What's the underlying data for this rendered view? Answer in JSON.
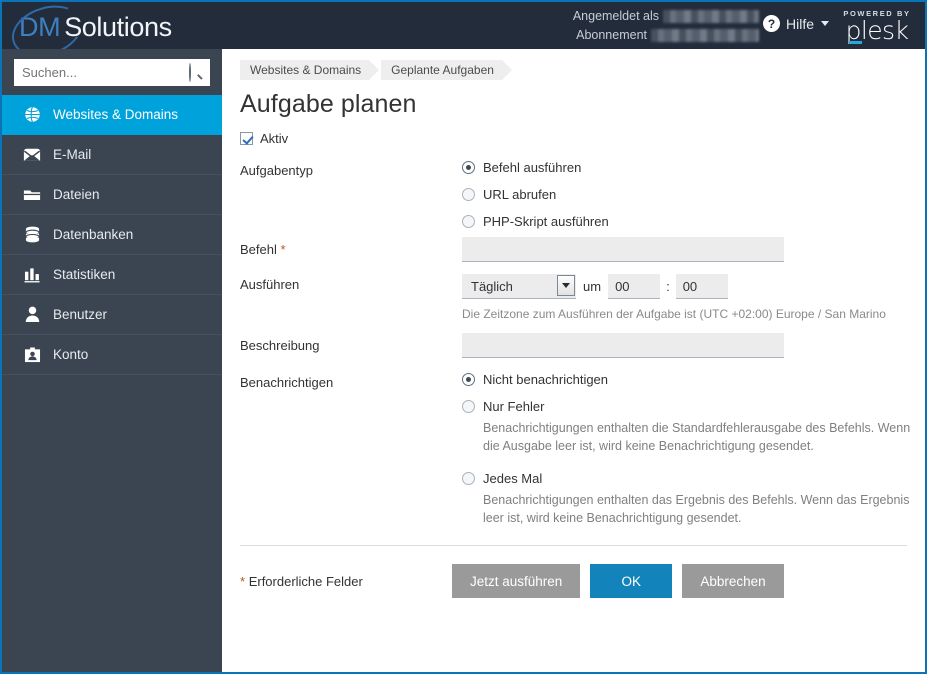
{
  "header": {
    "brand_dm": "DM",
    "brand_solutions": "Solutions",
    "logged_in_label": "Angemeldet als",
    "subscription_label": "Abonnement",
    "logged_in_value": "",
    "subscription_value": "",
    "help_label": "Hilfe",
    "help_icon": "question-mark-circle-icon",
    "caret_icon": "chevron-down-icon",
    "powered_by": "POWERED BY",
    "plesk_word": "plesk",
    "bg_color": "#232c3b",
    "accent_color": "#0a74b8"
  },
  "sidebar": {
    "search": {
      "placeholder": "Suchen...",
      "value": "",
      "icon": "search-icon"
    },
    "active_color": "#00a2db",
    "bg_color": "#3b4552",
    "items": [
      {
        "label": "Websites & Domains",
        "icon": "globe-icon",
        "active": true
      },
      {
        "label": "E-Mail",
        "icon": "envelope-icon",
        "active": false
      },
      {
        "label": "Dateien",
        "icon": "folder-icon",
        "active": false
      },
      {
        "label": "Datenbanken",
        "icon": "database-icon",
        "active": false
      },
      {
        "label": "Statistiken",
        "icon": "bar-chart-icon",
        "active": false
      },
      {
        "label": "Benutzer",
        "icon": "user-icon",
        "active": false
      },
      {
        "label": "Konto",
        "icon": "id-card-icon",
        "active": false
      }
    ]
  },
  "breadcrumb": [
    {
      "label": "Websites & Domains"
    },
    {
      "label": "Geplante Aufgaben"
    }
  ],
  "page": {
    "title": "Aufgabe planen",
    "active_checkbox": {
      "label": "Aktiv",
      "checked": true
    }
  },
  "form": {
    "task_type": {
      "label": "Aufgabentyp",
      "options": [
        {
          "label": "Befehl ausführen",
          "selected": true
        },
        {
          "label": "URL abrufen",
          "selected": false
        },
        {
          "label": "PHP-Skript ausführen",
          "selected": false
        }
      ]
    },
    "command": {
      "label": "Befehl",
      "required_marker": "*",
      "value": "",
      "placeholder": ""
    },
    "run": {
      "label": "Ausführen",
      "frequency_value": "Täglich",
      "at_label": "um",
      "hour_value": "00",
      "colon": ":",
      "minute_value": "00",
      "timezone_hint": "Die Zeitzone zum Ausführen der Aufgabe ist (UTC +02:00) Europe / San Marino"
    },
    "description": {
      "label": "Beschreibung",
      "value": "",
      "placeholder": ""
    },
    "notify": {
      "label": "Benachrichtigen",
      "options": [
        {
          "label": "Nicht benachrichtigen",
          "selected": true,
          "hint": ""
        },
        {
          "label": "Nur Fehler",
          "selected": false,
          "hint": "Benachrichtigungen enthalten die Standardfehlerausgabe des Befehls. Wenn die Ausgabe leer ist, wird keine Benachrichtigung gesendet."
        },
        {
          "label": "Jedes Mal",
          "selected": false,
          "hint": "Benachrichtigungen enthalten das Ergebnis des Befehls. Wenn das Ergebnis leer ist, wird keine Benachrichtigung gesendet."
        }
      ]
    }
  },
  "footer": {
    "required_note_marker": "*",
    "required_note": "Erforderliche Felder",
    "run_now_label": "Jetzt ausführen",
    "ok_label": "OK",
    "cancel_label": "Abbrechen",
    "ok_color": "#1283bb",
    "grey_color": "#9a9a9a"
  }
}
